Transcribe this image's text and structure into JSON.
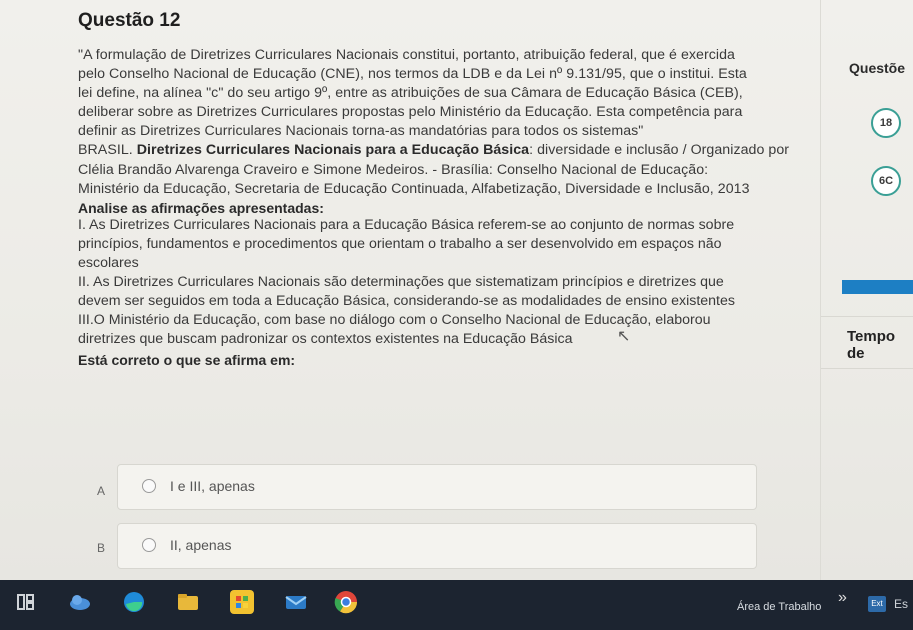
{
  "question": {
    "title": "Questão 12",
    "paragraph_lines": [
      "\"A formulação de Diretrizes Curriculares Nacionais constitui, portanto, atribuição federal, que é exercida",
      "pelo Conselho Nacional de Educação (CNE), nos termos da LDB e da Lei nº 9.131/95, que o institui. Esta",
      "lei define, na alínea \"c\" do seu artigo 9º, entre as atribuições de sua Câmara de Educação Básica (CEB),",
      "deliberar sobre as Diretrizes Curriculares propostas pelo Ministério da Educação. Esta competência para",
      "definir as Diretrizes Curriculares Nacionais torna-as mandatórias para todos os sistemas\""
    ],
    "source_prefix": "BRASIL. ",
    "source_bold": "Diretrizes Curriculares Nacionais para a Educação Básica",
    "source_lines": [
      ": diversidade e inclusão / Organizado por",
      "Clélia Brandão Alvarenga Craveiro e Simone Medeiros. - Brasília: Conselho Nacional de Educação:",
      "Ministério da Educação, Secretaria de Educação Continuada, Alfabetização, Diversidade e Inclusão, 2013"
    ],
    "lead": "Analise as afirmações apresentadas:",
    "statements": [
      "I. As Diretrizes Curriculares Nacionais para a Educação Básica referem-se ao conjunto de normas sobre",
      "princípios, fundamentos e procedimentos que orientam o trabalho a ser desenvolvido em espaços não",
      "escolares",
      "II. As Diretrizes Curriculares Nacionais são determinações que sistematizam princípios e diretrizes que",
      "devem ser seguidos em toda a Educação Básica, considerando-se as modalidades de ensino existentes",
      "III.O Ministério da Educação, com base no diálogo com o Conselho Nacional de Educação, elaborou",
      "diretrizes que buscam padronizar os contextos existentes na Educação Básica"
    ],
    "ask": "Está correto o que se afirma em:",
    "options": [
      {
        "letter": "A",
        "text": "I e III, apenas"
      },
      {
        "letter": "B",
        "text": "II, apenas"
      }
    ]
  },
  "sidebar": {
    "title": "Questõe",
    "badge1": "18",
    "badge2": "6C",
    "tempo": "Tempo de"
  },
  "taskbar": {
    "workspace_label": "Área de Trabalho",
    "quote": "»",
    "badge": "Ext",
    "edge_text": "Es"
  },
  "colors": {
    "accent_teal": "#3a9f95",
    "accent_blue": "#1d7fc4",
    "taskbar": "#1c2430"
  }
}
